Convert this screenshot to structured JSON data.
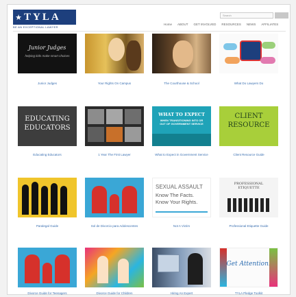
{
  "header": {
    "logo_text": "TYLA",
    "tagline": "BE AN EXCEPTIONAL LAWYER",
    "search_placeholder": "Search",
    "nav": [
      "Home",
      "ABOUT",
      "GET INVOLVED",
      "RESOURCES",
      "NEWS",
      "AFFILIATES"
    ]
  },
  "tiles": [
    {
      "caption": "Junior Judges",
      "title": "Junior Judges",
      "subtitle": "helping kids make smart choices"
    },
    {
      "caption": "Your Rights On Campus"
    },
    {
      "caption": "The Courthouse & School"
    },
    {
      "caption": "What Do Lawyers Do"
    },
    {
      "caption": "Educating Educators",
      "title": "EDUCATING EDUCATORS"
    },
    {
      "caption": "1 Year The First Lawyer"
    },
    {
      "caption": "What to Expect in Government Service",
      "title": "WHAT TO EXPECT",
      "subtitle": "WHEN TRANSITIONING INTO OR OUT OF GOVERNMENT SERVICE"
    },
    {
      "caption": "Client Resource Guide",
      "title": "CLIENT RESOURCE"
    },
    {
      "caption": "Paralegal Guide"
    },
    {
      "caption": "Sol de Divorcio para Adolescentes"
    },
    {
      "caption": "Not A Victim",
      "title": "SEXUAL ASSAULT",
      "subtitle": "Know The Facts. Know Your Rights."
    },
    {
      "caption": "Professional Etiquette Guide",
      "title": "PROFESSIONAL ETIQUETTE"
    },
    {
      "caption": "Divorce Guide for Teenagers"
    },
    {
      "caption": "Divorce Guide for Children"
    },
    {
      "caption": "Hiring An Expert"
    },
    {
      "caption": "TYLA Pledge Toolkit",
      "title": "Get Attention!"
    }
  ],
  "colors": {
    "brand": "#1d3f7d",
    "link": "#3a6fb0"
  }
}
